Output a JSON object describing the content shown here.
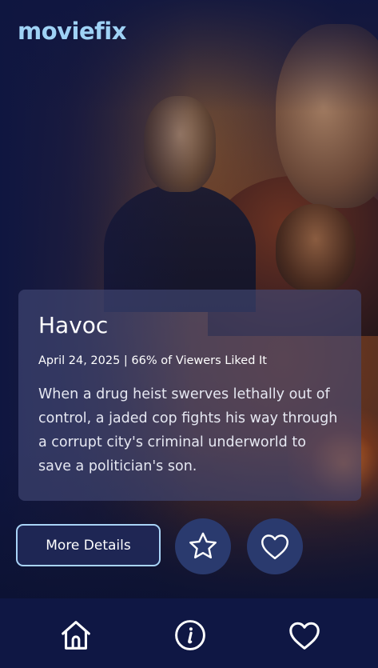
{
  "app": {
    "logo_text": "moviefix"
  },
  "movie": {
    "title": "Havoc",
    "meta": "April 24, 2025 | 66% of Viewers Liked It",
    "description": "When a drug heist swerves lethally out of control, a jaded cop fights his way through a corrupt city's criminal underworld to save a politician's son."
  },
  "actions": {
    "details_label": "More Details",
    "watchlist_icon": "star-icon",
    "favorite_icon": "heart-icon"
  },
  "nav": {
    "items": [
      {
        "icon": "home-icon"
      },
      {
        "icon": "info-icon"
      },
      {
        "icon": "heart-icon"
      }
    ]
  },
  "colors": {
    "logo": "#9fd2f5",
    "accent_border": "#a9d4f7",
    "nav_background": "#0f1744",
    "circle_button": "#2a3a6e",
    "card_background": "#444a78"
  }
}
